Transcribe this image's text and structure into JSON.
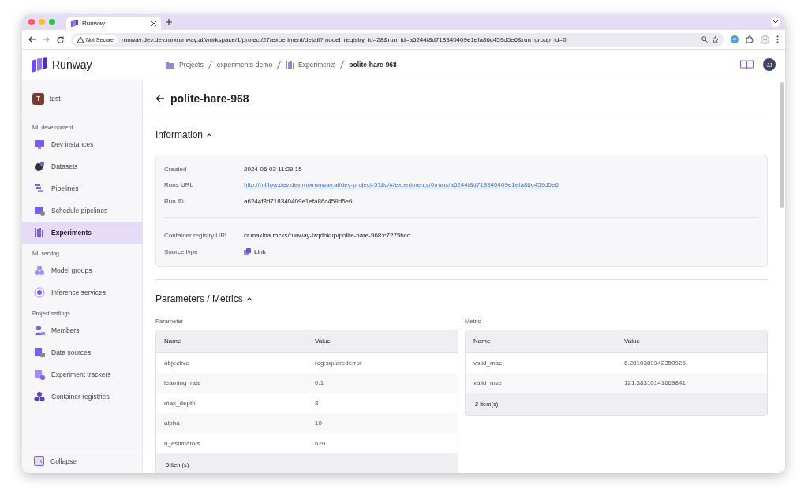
{
  "browser": {
    "tab_title": "Runway",
    "security_label": "Not Secure",
    "url": "runway.dev.dev.mrxrunway.ai/workspace/1/project/27/experiment/detail?model_registry_id=28&run_id=a6244f8d718340409e1efa86c459d5e6&run_group_id=0"
  },
  "header": {
    "brand": "Runway",
    "breadcrumbs": [
      {
        "label": "Projects",
        "kind": "folder",
        "current": false
      },
      {
        "label": "experiments-demo",
        "kind": "plain",
        "current": false
      },
      {
        "label": "Experiments",
        "kind": "grid",
        "current": false
      },
      {
        "label": "polite-hare-968",
        "kind": "plain",
        "current": true
      }
    ],
    "avatar": "JJ"
  },
  "sidebar": {
    "project": {
      "initial": "T",
      "name": "test"
    },
    "sections": [
      {
        "title": "ML development",
        "items": [
          {
            "label": "Dev instances",
            "selected": false
          },
          {
            "label": "Datasets",
            "selected": false
          },
          {
            "label": "Pipelines",
            "selected": false
          },
          {
            "label": "Schedule pipelines",
            "selected": false
          },
          {
            "label": "Experiments",
            "selected": true
          }
        ]
      },
      {
        "title": "ML serving",
        "items": [
          {
            "label": "Model groups",
            "selected": false
          },
          {
            "label": "Inference services",
            "selected": false
          }
        ]
      },
      {
        "title": "Project settings",
        "items": [
          {
            "label": "Members",
            "selected": false
          },
          {
            "label": "Data sources",
            "selected": false
          },
          {
            "label": "Experiment trackers",
            "selected": false
          },
          {
            "label": "Container registries",
            "selected": false
          }
        ]
      }
    ],
    "collapse": "Collapse"
  },
  "page": {
    "title": "polite-hare-968",
    "information": {
      "heading": "Information",
      "expanded": true,
      "groups": [
        [
          {
            "label": "Created",
            "value": "2024-06-03 11:29:15",
            "kind": "text"
          },
          {
            "label": "Runs URL",
            "value": "http://mlflow.dev.dev.mrxrunway.ai/dev-project-518c/#/experiments/0/runs/a6244f8d718340409e1efa86c459d5e6",
            "kind": "link"
          },
          {
            "label": "Run ID",
            "value": "a6244f8d718340409e1efa86c459d5e6",
            "kind": "text"
          }
        ],
        [
          {
            "label": "Container registry URL",
            "value": "cr.makina.rocks/runway-izqdbkup/polite-hare-968:c7275bcc",
            "kind": "text"
          },
          {
            "label": "Source type",
            "value": "Link",
            "kind": "source"
          }
        ]
      ]
    },
    "parameters": {
      "heading": "Parameters / Metrics",
      "expanded": true,
      "tables": [
        {
          "caption": "Parameter",
          "columns": [
            "Name",
            "Value"
          ],
          "rows": [
            [
              "objective",
              "reg:squarederror"
            ],
            [
              "learning_rate",
              "0.1"
            ],
            [
              "max_depth",
              "8"
            ],
            [
              "alpha",
              "10"
            ],
            [
              "n_estimators",
              "620"
            ]
          ],
          "footer": "5 item(s)"
        },
        {
          "caption": "Metric",
          "columns": [
            "Name",
            "Value"
          ],
          "rows": [
            [
              "valid_mae",
              "6.2810389342350925"
            ],
            [
              "valid_mse",
              "121.38310141669841"
            ]
          ],
          "footer": "2 item(s)"
        }
      ]
    }
  }
}
